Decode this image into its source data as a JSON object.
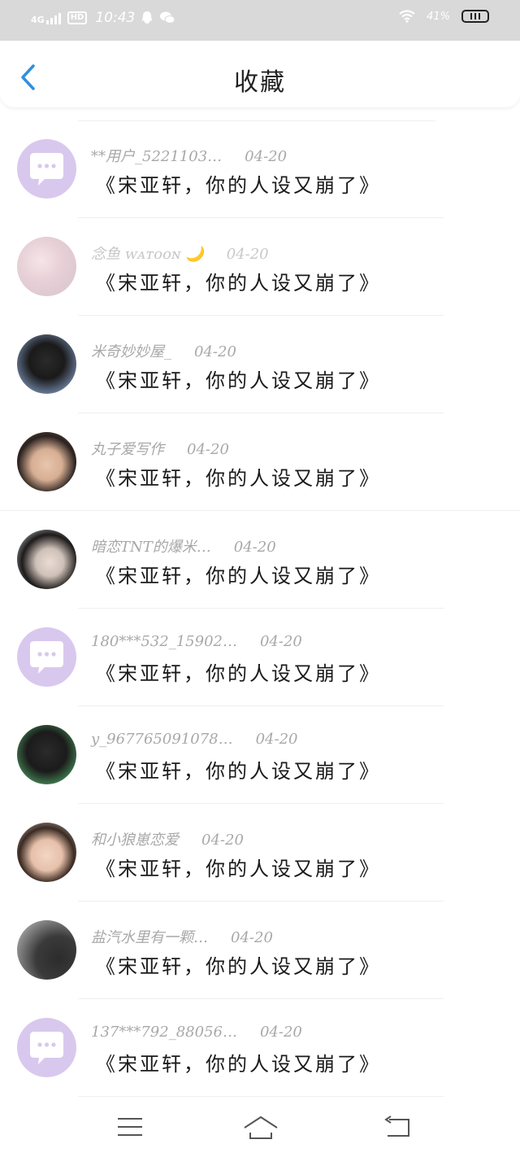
{
  "status_bar": {
    "network": "4G",
    "hd": "HD",
    "time": "10:43",
    "battery_percent": "41%"
  },
  "header": {
    "title": "收藏",
    "back_icon": "chevron-left-icon",
    "accent_color": "#2f8fe0"
  },
  "favorites": [
    {
      "user": "**用户_5221103…",
      "date": "04-20",
      "content": "《宋亚轩，你的人设又崩了》",
      "avatar": "default-chat-avatar"
    },
    {
      "user": "念鱼 ᴡᴀᴛᴏᴏɴ 🌙",
      "date": "04-20",
      "content": "《宋亚轩，你的人设又崩了》",
      "avatar": "photo-avatar"
    },
    {
      "user": "米奇妙妙屋_",
      "date": "04-20",
      "content": "《宋亚轩，你的人设又崩了》",
      "avatar": "photo-avatar"
    },
    {
      "user": "丸子爱写作",
      "date": "04-20",
      "content": "《宋亚轩，你的人设又崩了》",
      "avatar": "photo-avatar"
    },
    {
      "user": "暗恋TNT的爆米…",
      "date": "04-20",
      "content": "《宋亚轩，你的人设又崩了》",
      "avatar": "photo-avatar"
    },
    {
      "user": "180***532_15902…",
      "date": "04-20",
      "content": "《宋亚轩，你的人设又崩了》",
      "avatar": "default-chat-avatar"
    },
    {
      "user": "y_967765091078…",
      "date": "04-20",
      "content": "《宋亚轩，你的人设又崩了》",
      "avatar": "photo-avatar"
    },
    {
      "user": "和小狼崽恋爱",
      "date": "04-20",
      "content": "《宋亚轩，你的人设又崩了》",
      "avatar": "photo-avatar"
    },
    {
      "user": "盐汽水里有一颗…",
      "date": "04-20",
      "content": "《宋亚轩，你的人设又崩了》",
      "avatar": "photo-avatar"
    },
    {
      "user": "137***792_88056…",
      "date": "04-20",
      "content": "《宋亚轩，你的人设又崩了》",
      "avatar": "default-chat-avatar"
    }
  ],
  "nav_bar": {
    "menu_icon": "menu-icon",
    "home_icon": "home-icon",
    "back_icon": "return-icon"
  }
}
